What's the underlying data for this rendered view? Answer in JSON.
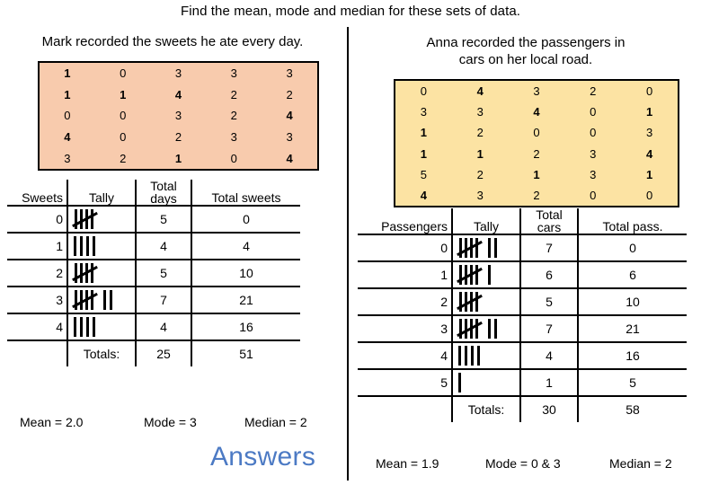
{
  "title": "Find the mean, mode and median for these sets of data.",
  "answers_word": "Answers",
  "colors": {
    "peach_table": "#F8CBAD",
    "yellow_table": "#FCE3A3",
    "answers_blue": "#4C7AC4",
    "rule": "#000000"
  },
  "left": {
    "subtitle": "Mark recorded the sweets he ate every day.",
    "raw_rows": [
      [
        {
          "v": "1",
          "bold": true
        },
        {
          "v": "0",
          "bold": false
        },
        {
          "v": "3",
          "bold": false
        },
        {
          "v": "3",
          "bold": false
        },
        {
          "v": "3",
          "bold": false
        }
      ],
      [
        {
          "v": "1",
          "bold": true
        },
        {
          "v": "1",
          "bold": true
        },
        {
          "v": "4",
          "bold": true
        },
        {
          "v": "2",
          "bold": false
        },
        {
          "v": "2",
          "bold": false
        }
      ],
      [
        {
          "v": "0",
          "bold": false
        },
        {
          "v": "0",
          "bold": false
        },
        {
          "v": "3",
          "bold": false
        },
        {
          "v": "2",
          "bold": false
        },
        {
          "v": "4",
          "bold": true
        }
      ],
      [
        {
          "v": "4",
          "bold": true
        },
        {
          "v": "0",
          "bold": false
        },
        {
          "v": "2",
          "bold": false
        },
        {
          "v": "3",
          "bold": false
        },
        {
          "v": "3",
          "bold": false
        }
      ],
      [
        {
          "v": "3",
          "bold": false
        },
        {
          "v": "2",
          "bold": false
        },
        {
          "v": "1",
          "bold": true
        },
        {
          "v": "0",
          "bold": false
        },
        {
          "v": "4",
          "bold": true
        }
      ]
    ],
    "headers": {
      "category": "Sweets",
      "tally": "Tally",
      "count_top": "Total",
      "count_bottom": "days",
      "total": "Total sweets"
    },
    "rows": [
      {
        "category": "0",
        "fives": 1,
        "ones": 0,
        "count": "5",
        "total": "0"
      },
      {
        "category": "1",
        "fives": 0,
        "ones": 4,
        "count": "4",
        "total": "4"
      },
      {
        "category": "2",
        "fives": 1,
        "ones": 0,
        "count": "5",
        "total": "10"
      },
      {
        "category": "3",
        "fives": 1,
        "ones": 2,
        "count": "7",
        "total": "21"
      },
      {
        "category": "4",
        "fives": 0,
        "ones": 4,
        "count": "4",
        "total": "16"
      }
    ],
    "totals_label": "Totals:",
    "totals_count": "25",
    "totals_total": "51",
    "mean": "Mean = 2.0",
    "mode": "Mode = 3",
    "median": "Median = 2"
  },
  "right": {
    "subtitle_line1": "Anna recorded the passengers in",
    "subtitle_line2": "cars on her local road.",
    "raw_rows": [
      [
        {
          "v": "0",
          "bold": false
        },
        {
          "v": "4",
          "bold": true
        },
        {
          "v": "3",
          "bold": false
        },
        {
          "v": "2",
          "bold": false
        },
        {
          "v": "0",
          "bold": false
        }
      ],
      [
        {
          "v": "3",
          "bold": false
        },
        {
          "v": "3",
          "bold": false
        },
        {
          "v": "4",
          "bold": true
        },
        {
          "v": "0",
          "bold": false
        },
        {
          "v": "1",
          "bold": true
        }
      ],
      [
        {
          "v": "1",
          "bold": true
        },
        {
          "v": "2",
          "bold": false
        },
        {
          "v": "0",
          "bold": false
        },
        {
          "v": "0",
          "bold": false
        },
        {
          "v": "3",
          "bold": false
        }
      ],
      [
        {
          "v": "1",
          "bold": true
        },
        {
          "v": "1",
          "bold": true
        },
        {
          "v": "2",
          "bold": false
        },
        {
          "v": "3",
          "bold": false
        },
        {
          "v": "4",
          "bold": true
        }
      ],
      [
        {
          "v": "5",
          "bold": false
        },
        {
          "v": "2",
          "bold": false
        },
        {
          "v": "1",
          "bold": true
        },
        {
          "v": "3",
          "bold": false
        },
        {
          "v": "1",
          "bold": true
        }
      ],
      [
        {
          "v": "4",
          "bold": true
        },
        {
          "v": "3",
          "bold": false
        },
        {
          "v": "2",
          "bold": false
        },
        {
          "v": "0",
          "bold": false
        },
        {
          "v": "0",
          "bold": false
        }
      ]
    ],
    "headers": {
      "category": "Passengers",
      "tally": "Tally",
      "count_top": "Total",
      "count_bottom": "cars",
      "total": "Total pass."
    },
    "rows": [
      {
        "category": "0",
        "fives": 1,
        "ones": 2,
        "count": "7",
        "total": "0"
      },
      {
        "category": "1",
        "fives": 1,
        "ones": 1,
        "count": "6",
        "total": "6"
      },
      {
        "category": "2",
        "fives": 1,
        "ones": 0,
        "count": "5",
        "total": "10"
      },
      {
        "category": "3",
        "fives": 1,
        "ones": 2,
        "count": "7",
        "total": "21"
      },
      {
        "category": "4",
        "fives": 0,
        "ones": 4,
        "count": "4",
        "total": "16"
      },
      {
        "category": "5",
        "fives": 0,
        "ones": 1,
        "count": "1",
        "total": "5"
      }
    ],
    "totals_label": "Totals:",
    "totals_count": "30",
    "totals_total": "58",
    "mean": "Mean = 1.9",
    "mode": "Mode = 0 & 3",
    "median": "Median = 2"
  }
}
